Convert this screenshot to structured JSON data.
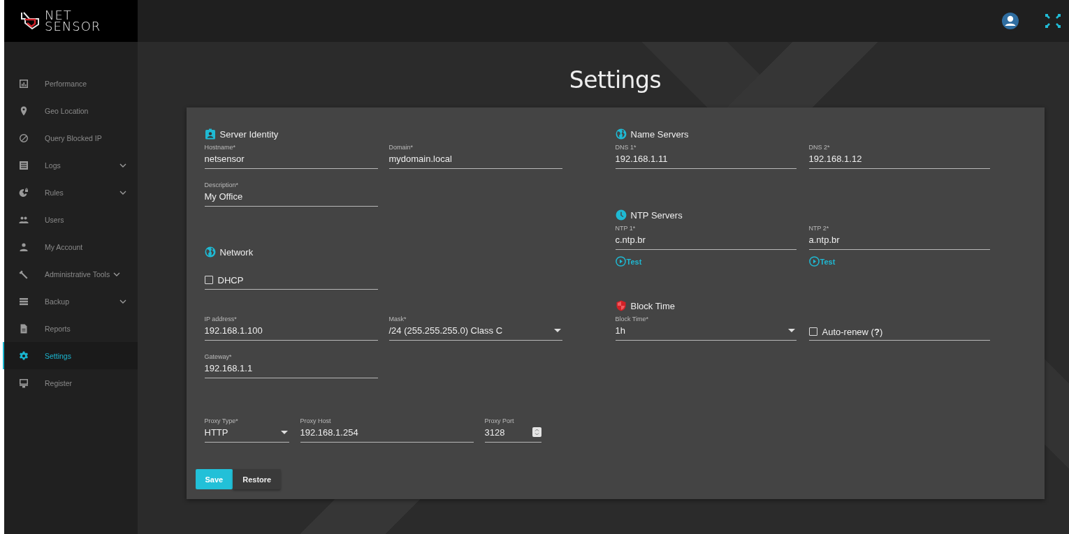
{
  "brand": {
    "line1": "NET",
    "line2": "SENSOR"
  },
  "sidebar": {
    "items": [
      {
        "label": "Performance",
        "kind": "chart",
        "expandable": false,
        "selected": false
      },
      {
        "label": "Geo Location",
        "kind": "pin",
        "expandable": false,
        "selected": false
      },
      {
        "label": "Query Blocked IP",
        "kind": "block",
        "expandable": false,
        "selected": false
      },
      {
        "label": "Logs",
        "kind": "list",
        "expandable": true,
        "selected": false
      },
      {
        "label": "Rules",
        "kind": "globe",
        "expandable": true,
        "selected": false
      },
      {
        "label": "Users",
        "kind": "users",
        "expandable": false,
        "selected": false
      },
      {
        "label": "My Account",
        "kind": "person",
        "expandable": false,
        "selected": false
      },
      {
        "label": "Administrative Tools",
        "kind": "wrench",
        "expandable": true,
        "selected": false
      },
      {
        "label": "Backup",
        "kind": "server",
        "expandable": true,
        "selected": false
      },
      {
        "label": "Reports",
        "kind": "doc",
        "expandable": false,
        "selected": false
      },
      {
        "label": "Settings",
        "kind": "gear",
        "expandable": false,
        "selected": true
      },
      {
        "label": "Register",
        "kind": "monitor",
        "expandable": false,
        "selected": false
      }
    ]
  },
  "page_title": "Settings",
  "columns": [
    {
      "sections": [
        {
          "title": "Server Identity",
          "kind": "badge",
          "rows": [
            [
              {
                "kind": "text",
                "label": "Hostname*",
                "value": "netsensor"
              },
              {
                "kind": "text",
                "label": "Domain*",
                "value": "mydomain.local"
              }
            ],
            [
              {
                "kind": "text",
                "label": "Description*",
                "value": "My Office"
              }
            ]
          ]
        },
        {
          "title": "Network",
          "kind": "globe",
          "rows": [
            [
              {
                "kind": "checkbox",
                "label": "DHCP",
                "checked": false
              }
            ],
            [
              {
                "kind": "text",
                "label": "IP address*",
                "value": "192.168.1.100"
              },
              {
                "kind": "select",
                "label": "Mask*",
                "value": "/24 (255.255.255.0) Class C"
              }
            ],
            [
              {
                "kind": "text",
                "label": "Gateway*",
                "value": "192.168.1.1"
              }
            ]
          ]
        },
        {
          "rows": [
            [
              {
                "kind": "select",
                "label": "Proxy Type*",
                "value": "HTTP"
              },
              {
                "kind": "text",
                "label": "Proxy Host",
                "value": "192.168.1.254"
              },
              {
                "kind": "number",
                "label": "Proxy Port",
                "value": "3128"
              }
            ]
          ]
        }
      ]
    },
    {
      "sections": [
        {
          "title": "Name Servers",
          "kind": "globe",
          "rows": [
            [
              {
                "kind": "text",
                "label": "DNS 1*",
                "value": "192.168.1.11"
              },
              {
                "kind": "text",
                "label": "DNS 2*",
                "value": "192.168.1.12"
              }
            ]
          ]
        },
        {
          "title": "NTP Servers",
          "kind": "clock",
          "rows": [
            [
              {
                "kind": "text",
                "label": "NTP 1*",
                "value": "c.ntp.br",
                "action": "Test"
              },
              {
                "kind": "text",
                "label": "NTP 2*",
                "value": "a.ntp.br",
                "action": "Test"
              }
            ]
          ]
        },
        {
          "title": "Block Time",
          "kind": "shield",
          "rows": [
            [
              {
                "kind": "select",
                "label": "Block Time*",
                "value": "1h"
              },
              {
                "kind": "checkbox",
                "label": "Auto-renew (**?**)",
                "checked": false
              }
            ]
          ]
        }
      ]
    }
  ],
  "buttons": [
    {
      "label": "Save",
      "primary": true
    },
    {
      "label": "Restore",
      "primary": false
    }
  ]
}
